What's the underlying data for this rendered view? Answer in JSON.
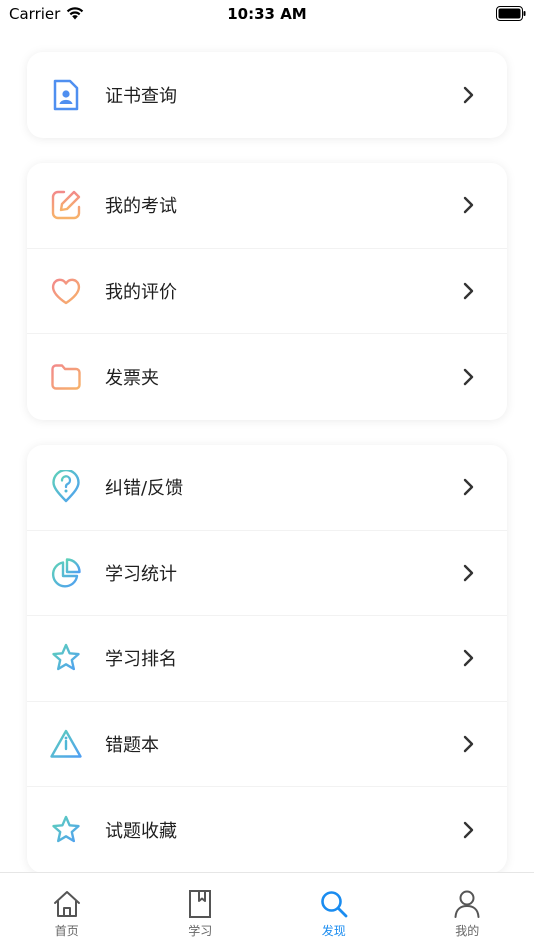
{
  "status_bar": {
    "carrier": "Carrier",
    "time": "10:33 AM"
  },
  "cards": [
    {
      "items": [
        {
          "label": "证书查询",
          "icon": "certificate-icon"
        }
      ]
    },
    {
      "items": [
        {
          "label": "我的考试",
          "icon": "edit-icon"
        },
        {
          "label": "我的评价",
          "icon": "heart-icon"
        },
        {
          "label": "发票夹",
          "icon": "folder-icon"
        }
      ]
    },
    {
      "items": [
        {
          "label": "纠错/反馈",
          "icon": "question-pin-icon"
        },
        {
          "label": "学习统计",
          "icon": "pie-chart-icon"
        },
        {
          "label": "学习排名",
          "icon": "star-icon"
        },
        {
          "label": "错题本",
          "icon": "warning-icon"
        },
        {
          "label": "试题收藏",
          "icon": "star-icon"
        }
      ]
    }
  ],
  "tabs": [
    {
      "label": "首页",
      "icon": "home-icon",
      "active": false
    },
    {
      "label": "学习",
      "icon": "book-icon",
      "active": false
    },
    {
      "label": "发现",
      "icon": "search-icon",
      "active": true
    },
    {
      "label": "我的",
      "icon": "user-icon",
      "active": false
    }
  ],
  "colors": {
    "accent": "#1a8cf0",
    "warm_gradient": [
      "#f28a8a",
      "#f7b26a"
    ],
    "cool_gradient": [
      "#5ed1b8",
      "#4f9ff2"
    ],
    "cert_blue": "#4f8ff0"
  }
}
